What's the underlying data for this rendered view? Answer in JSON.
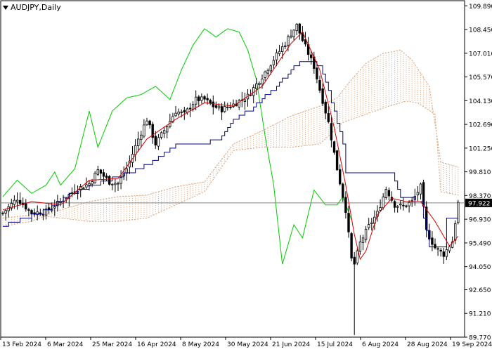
{
  "chart_data": {
    "type": "candlestick",
    "title": "AUDJPY,Daily",
    "current_price_label": "97.922",
    "ylim": [
      89.77,
      110.2
    ],
    "y_ticks": [
      "109.890",
      "108.450",
      "107.010",
      "105.570",
      "104.130",
      "102.690",
      "101.250",
      "99.810",
      "98.370",
      "96.930",
      "95.490",
      "94.050",
      "92.650",
      "91.210",
      "89.770"
    ],
    "x_ticks": [
      "13 Feb 2024",
      "6 Mar 2024",
      "25 Mar 2024",
      "16 Apr 2024",
      "8 May 2024",
      "30 May 2024",
      "21 Jun 2024",
      "15 Jul 2024",
      "6 Aug 2024",
      "28 Aug 2024",
      "19 Sep 2024"
    ],
    "bars_count": 159,
    "grid": false,
    "legend": "none",
    "colors": {
      "candles": "#000000",
      "tenkan": "#d40000",
      "kijun": "#000080",
      "chikou": "#00cc00",
      "kumo": "#d9a27a",
      "price_line": "#808080",
      "price_label_bg": "#000000",
      "price_label_text": "#ffffff"
    },
    "close_anchors": [
      [
        0,
        97.3
      ],
      [
        5,
        98.2
      ],
      [
        10,
        97.3
      ],
      [
        15,
        97.4
      ],
      [
        20,
        98.0
      ],
      [
        25,
        98.7
      ],
      [
        30,
        99.1
      ],
      [
        33,
        99.9
      ],
      [
        37,
        99.2
      ],
      [
        40,
        99.1
      ],
      [
        43,
        100.0
      ],
      [
        47,
        101.8
      ],
      [
        50,
        103.0
      ],
      [
        53,
        101.5
      ],
      [
        57,
        102.6
      ],
      [
        60,
        103.5
      ],
      [
        63,
        103.3
      ],
      [
        67,
        104.2
      ],
      [
        70,
        104.2
      ],
      [
        73,
        103.8
      ],
      [
        76,
        103.6
      ],
      [
        80,
        103.9
      ],
      [
        85,
        104.4
      ],
      [
        90,
        105.6
      ],
      [
        95,
        106.9
      ],
      [
        98,
        107.6
      ],
      [
        100,
        108.2
      ],
      [
        102,
        108.7
      ],
      [
        104,
        107.8
      ],
      [
        106,
        107.0
      ],
      [
        108,
        106.2
      ],
      [
        110,
        104.8
      ],
      [
        113,
        102.8
      ],
      [
        116,
        100.0
      ],
      [
        119,
        97.5
      ],
      [
        121,
        94.5
      ],
      [
        122,
        94.2
      ],
      [
        124,
        95.5
      ],
      [
        127,
        96.5
      ],
      [
        130,
        97.3
      ],
      [
        133,
        98.8
      ],
      [
        136,
        97.8
      ],
      [
        139,
        97.7
      ],
      [
        142,
        98.0
      ],
      [
        145,
        98.9
      ],
      [
        147,
        96.2
      ],
      [
        150,
        95.2
      ],
      [
        153,
        94.8
      ],
      [
        156,
        95.6
      ],
      [
        158,
        97.9
      ]
    ],
    "tenkan_anchors": [
      [
        0,
        97.5
      ],
      [
        10,
        98.0
      ],
      [
        20,
        97.8
      ],
      [
        30,
        99.3
      ],
      [
        40,
        99.4
      ],
      [
        50,
        101.8
      ],
      [
        60,
        103.0
      ],
      [
        70,
        104.0
      ],
      [
        80,
        103.8
      ],
      [
        90,
        105.0
      ],
      [
        100,
        107.6
      ],
      [
        104,
        108.3
      ],
      [
        110,
        106.0
      ],
      [
        115,
        102.5
      ],
      [
        119,
        99.0
      ],
      [
        122,
        96.0
      ],
      [
        124,
        94.5
      ],
      [
        126,
        95.0
      ],
      [
        130,
        97.2
      ],
      [
        135,
        98.2
      ],
      [
        140,
        98.0
      ],
      [
        145,
        98.0
      ],
      [
        150,
        96.8
      ],
      [
        155,
        95.3
      ],
      [
        158,
        95.9
      ]
    ],
    "kijun_anchors": [
      [
        0,
        96.5
      ],
      [
        15,
        97.5
      ],
      [
        25,
        98.6
      ],
      [
        40,
        99.5
      ],
      [
        50,
        100.2
      ],
      [
        60,
        101.4
      ],
      [
        70,
        101.5
      ],
      [
        76,
        101.9
      ],
      [
        80,
        103.0
      ],
      [
        86,
        103.6
      ],
      [
        95,
        105.0
      ],
      [
        100,
        106.0
      ],
      [
        104,
        106.6
      ],
      [
        110,
        106.3
      ],
      [
        114,
        104.1
      ],
      [
        118,
        101.5
      ],
      [
        119,
        99.7
      ],
      [
        135,
        99.7
      ],
      [
        138,
        98.3
      ],
      [
        145,
        98.0
      ],
      [
        148,
        95.2
      ],
      [
        153,
        95.2
      ],
      [
        154,
        96.9
      ],
      [
        158,
        96.9
      ]
    ],
    "chikou_anchors": [
      [
        0,
        98.3
      ],
      [
        5,
        99.3
      ],
      [
        10,
        98.5
      ],
      [
        15,
        99.0
      ],
      [
        18,
        99.8
      ],
      [
        20,
        99.0
      ],
      [
        25,
        100.0
      ],
      [
        30,
        103.5
      ],
      [
        33,
        101.3
      ],
      [
        38,
        103.5
      ],
      [
        43,
        104.3
      ],
      [
        48,
        104.5
      ],
      [
        53,
        105.0
      ],
      [
        58,
        104.2
      ],
      [
        62,
        106.0
      ],
      [
        66,
        107.5
      ],
      [
        70,
        108.5
      ],
      [
        74,
        108.0
      ],
      [
        78,
        108.5
      ],
      [
        82,
        108.3
      ],
      [
        85,
        107.2
      ],
      [
        88,
        105.4
      ],
      [
        91,
        102.0
      ],
      [
        94,
        99.0
      ],
      [
        97,
        94.2
      ],
      [
        101,
        96.6
      ],
      [
        104,
        95.8
      ],
      [
        108,
        98.7
      ],
      [
        112,
        97.8
      ],
      [
        116,
        97.8
      ],
      [
        118,
        98.3
      ],
      [
        121,
        96.9
      ]
    ],
    "kumo_a_anchors": [
      [
        0,
        96.5
      ],
      [
        10,
        96.8
      ],
      [
        20,
        97.5
      ],
      [
        30,
        98.0
      ],
      [
        40,
        98.3
      ],
      [
        50,
        98.4
      ],
      [
        60,
        98.9
      ],
      [
        70,
        99.2
      ],
      [
        80,
        101.5
      ],
      [
        90,
        102.3
      ],
      [
        100,
        103.2
      ],
      [
        110,
        103.8
      ],
      [
        116,
        104.3
      ],
      [
        120,
        105.2
      ],
      [
        126,
        106.4
      ],
      [
        132,
        107.0
      ],
      [
        138,
        107.2
      ],
      [
        142,
        106.6
      ],
      [
        148,
        105.0
      ],
      [
        152,
        100.4
      ],
      [
        158,
        100.1
      ]
    ],
    "kumo_b_anchors": [
      [
        0,
        97.0
      ],
      [
        10,
        97.2
      ],
      [
        20,
        97.0
      ],
      [
        30,
        96.8
      ],
      [
        40,
        96.8
      ],
      [
        50,
        97.0
      ],
      [
        60,
        97.8
      ],
      [
        70,
        98.6
      ],
      [
        80,
        101.1
      ],
      [
        90,
        101.3
      ],
      [
        100,
        101.3
      ],
      [
        110,
        101.5
      ],
      [
        118,
        102.8
      ],
      [
        126,
        103.3
      ],
      [
        134,
        103.8
      ],
      [
        140,
        104.1
      ],
      [
        144,
        104.0
      ],
      [
        150,
        103.3
      ],
      [
        152,
        98.6
      ],
      [
        158,
        98.4
      ]
    ],
    "spike_low": [
      122,
      89.9
    ]
  }
}
